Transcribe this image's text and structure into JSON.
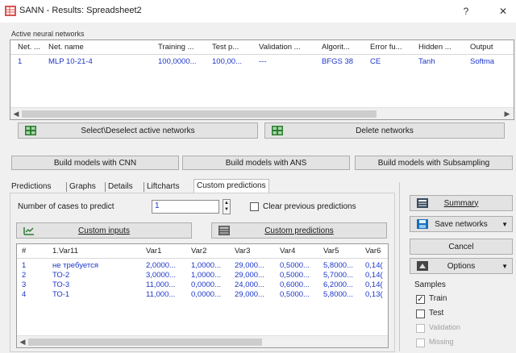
{
  "window": {
    "title": "SANN - Results: Spreadsheet2",
    "help_label": "?",
    "close_label": "✕"
  },
  "networks": {
    "group_label": "Active neural networks",
    "columns": [
      "Net. ...",
      "Net. name",
      "Training ...",
      "Test p...",
      "Validation ...",
      "Algorit...",
      "Error fu...",
      "Hidden ...",
      "Output"
    ],
    "rows": [
      [
        "1",
        "MLP 10-21-4",
        "100,0000...",
        "100,00...",
        "---",
        "BFGS 38",
        "CE",
        "Tanh",
        "Softma"
      ]
    ],
    "select_button": "Select\\Deselect active networks",
    "delete_button": "Delete networks"
  },
  "build": {
    "cnn": "Build models with CNN",
    "ans": "Build models with ANS",
    "subsampling": "Build models with Subsampling"
  },
  "tabs": [
    "Predictions",
    "Graphs",
    "Details",
    "Liftcharts",
    "Custom predictions"
  ],
  "custom": {
    "cases_label": "Number of cases to predict",
    "cases_value": "1",
    "clear_label": "Clear previous predictions",
    "custom_inputs": "Custom inputs",
    "custom_predictions": "Custom predictions",
    "columns": [
      "#",
      "1.Var11",
      "Var1",
      "Var2",
      "Var3",
      "Var4",
      "Var5",
      "Var6"
    ],
    "rows": [
      [
        "1",
        "не требуется",
        "2,0000...",
        "1,0000...",
        "29,000...",
        "0,5000...",
        "5,8000...",
        "0,14("
      ],
      [
        "2",
        "ТО-2",
        "3,0000...",
        "1,0000...",
        "29,000...",
        "0,5000...",
        "5,7000...",
        "0,14("
      ],
      [
        "3",
        "ТО-3",
        "11,000...",
        "0,0000...",
        "24,000...",
        "0,6000...",
        "6,2000...",
        "0,14("
      ],
      [
        "4",
        "ТО-1",
        "11,000...",
        "0,0000...",
        "29,000...",
        "0,5000...",
        "5,8000...",
        "0,13("
      ]
    ]
  },
  "side": {
    "summary": "Summary",
    "save_networks": "Save networks",
    "cancel": "Cancel",
    "options": "Options",
    "samples_label": "Samples",
    "samples": [
      {
        "label": "Train",
        "checked": true,
        "enabled": true
      },
      {
        "label": "Test",
        "checked": false,
        "enabled": true
      },
      {
        "label": "Validation",
        "checked": false,
        "enabled": false
      },
      {
        "label": "Missing",
        "checked": false,
        "enabled": false
      }
    ]
  },
  "icons": {
    "app": "spreadsheet-icon",
    "select": "grid-icon",
    "delete": "grid-icon",
    "custom_inputs": "chart-icon",
    "custom_predictions": "table-icon",
    "summary": "summary-icon",
    "save": "save-icon",
    "options": "options-icon"
  }
}
